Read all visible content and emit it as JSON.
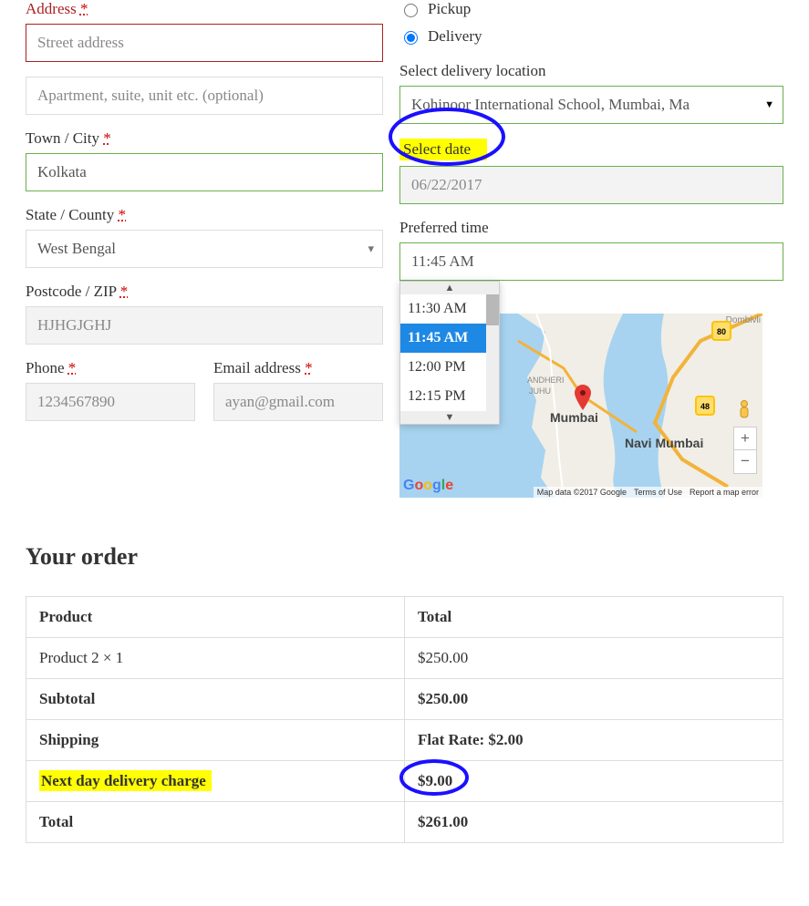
{
  "billing": {
    "address_label": "Address",
    "street_placeholder": "Street address",
    "apt_placeholder": "Apartment, suite, unit etc. (optional)",
    "city_label": "Town / City",
    "city_value": "Kolkata",
    "state_label": "State / County",
    "state_value": "West Bengal",
    "postcode_label": "Postcode / ZIP",
    "postcode_value": "HJHGJGHJ",
    "phone_label": "Phone",
    "phone_value": "1234567890",
    "email_label": "Email address",
    "email_value": "ayan@gmail.com",
    "required": "*"
  },
  "delivery": {
    "pickup_label": "Pickup",
    "delivery_label": "Delivery",
    "method_selected": "delivery",
    "loc_label": "Select delivery location",
    "loc_value": "Kohinoor International School, Mumbai, Ma",
    "date_label": "Select date",
    "date_value": "06/22/2017",
    "time_label": "Preferred time",
    "time_value": "11:45 AM",
    "time_options": [
      "11:30 AM",
      "11:45 AM",
      "12:00 PM",
      "12:15 PM"
    ]
  },
  "map": {
    "city1": "Mumbai",
    "city2": "Navi Mumbai",
    "sub1": "ANDHERI",
    "sub2": "JUHU",
    "sub3": "Dombivli",
    "route1": "80",
    "route2": "48",
    "logo": [
      "G",
      "o",
      "o",
      "g",
      "l",
      "e"
    ],
    "attr": "Map data ©2017 Google",
    "terms": "Terms of Use",
    "report": "Report a map error",
    "zoom_in": "+",
    "zoom_out": "−"
  },
  "order": {
    "heading": "Your order",
    "col_product": "Product",
    "col_total": "Total",
    "rows": [
      {
        "label": "Product 2  × 1",
        "value": "$250.00",
        "label_bold": false,
        "value_bold": false,
        "highlight_label": false,
        "circle_value": false
      },
      {
        "label": "Subtotal",
        "value": "$250.00",
        "label_bold": true,
        "value_bold": true,
        "highlight_label": false,
        "circle_value": false
      },
      {
        "label": "Shipping",
        "value": "Flat Rate: $2.00",
        "label_bold": true,
        "value_bold": true,
        "highlight_label": false,
        "circle_value": false
      },
      {
        "label": "Next day delivery charge",
        "value": "$9.00",
        "label_bold": true,
        "value_bold": true,
        "highlight_label": true,
        "circle_value": true
      },
      {
        "label": "Total",
        "value": "$261.00",
        "label_bold": true,
        "value_bold": true,
        "highlight_label": false,
        "circle_value": false
      }
    ]
  }
}
